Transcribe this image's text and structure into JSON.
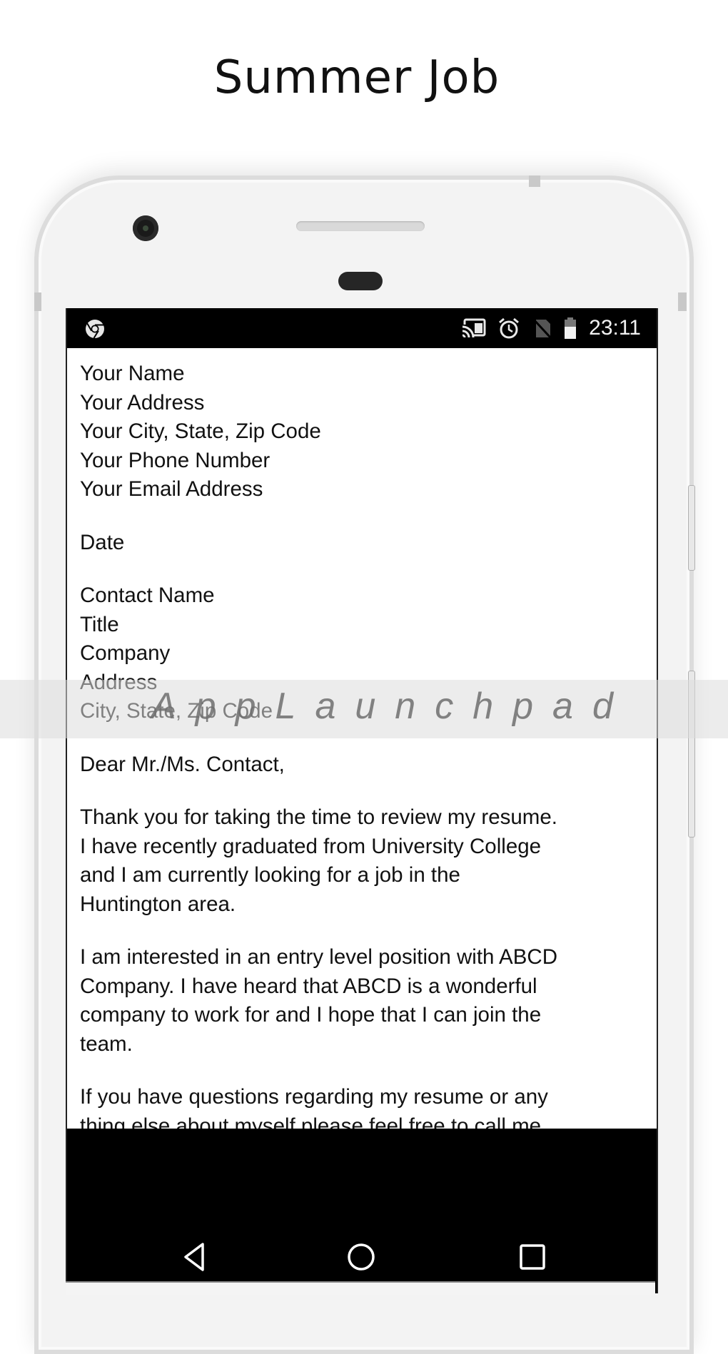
{
  "headline": "Summer Job",
  "status_bar": {
    "left_icons": [
      "chrome-icon"
    ],
    "right_icons": [
      "cast-icon",
      "alarm-icon",
      "no-sim-icon",
      "battery-icon"
    ],
    "time": "23:11"
  },
  "letter": {
    "sender": [
      "Your Name",
      "Your Address",
      "Your City, State, Zip Code",
      "Your Phone Number",
      "Your Email Address"
    ],
    "date": "Date",
    "recipient": [
      "Contact Name",
      "Title",
      "Company",
      "Address",
      "City, State, Zip Code"
    ],
    "salutation": "Dear Mr./Ms. Contact,",
    "paragraph1": [
      "Thank you for taking the time to review my resume.",
      "I have recently graduated from University College",
      "and I am currently looking for a job in the",
      "Huntington area."
    ],
    "paragraph2": [
      "I am interested in an entry level position with ABCD",
      "Company. I have heard that ABCD is a wonderful",
      "company to work for and I hope that I can join the",
      "team."
    ],
    "paragraph3": [
      "If you have questions regarding my resume or any",
      "thing else about myself please feel free to call me"
    ]
  },
  "nav_bar": {
    "buttons": [
      "back-icon",
      "home-icon",
      "recents-icon"
    ]
  },
  "watermark": "AppLaunchpad"
}
